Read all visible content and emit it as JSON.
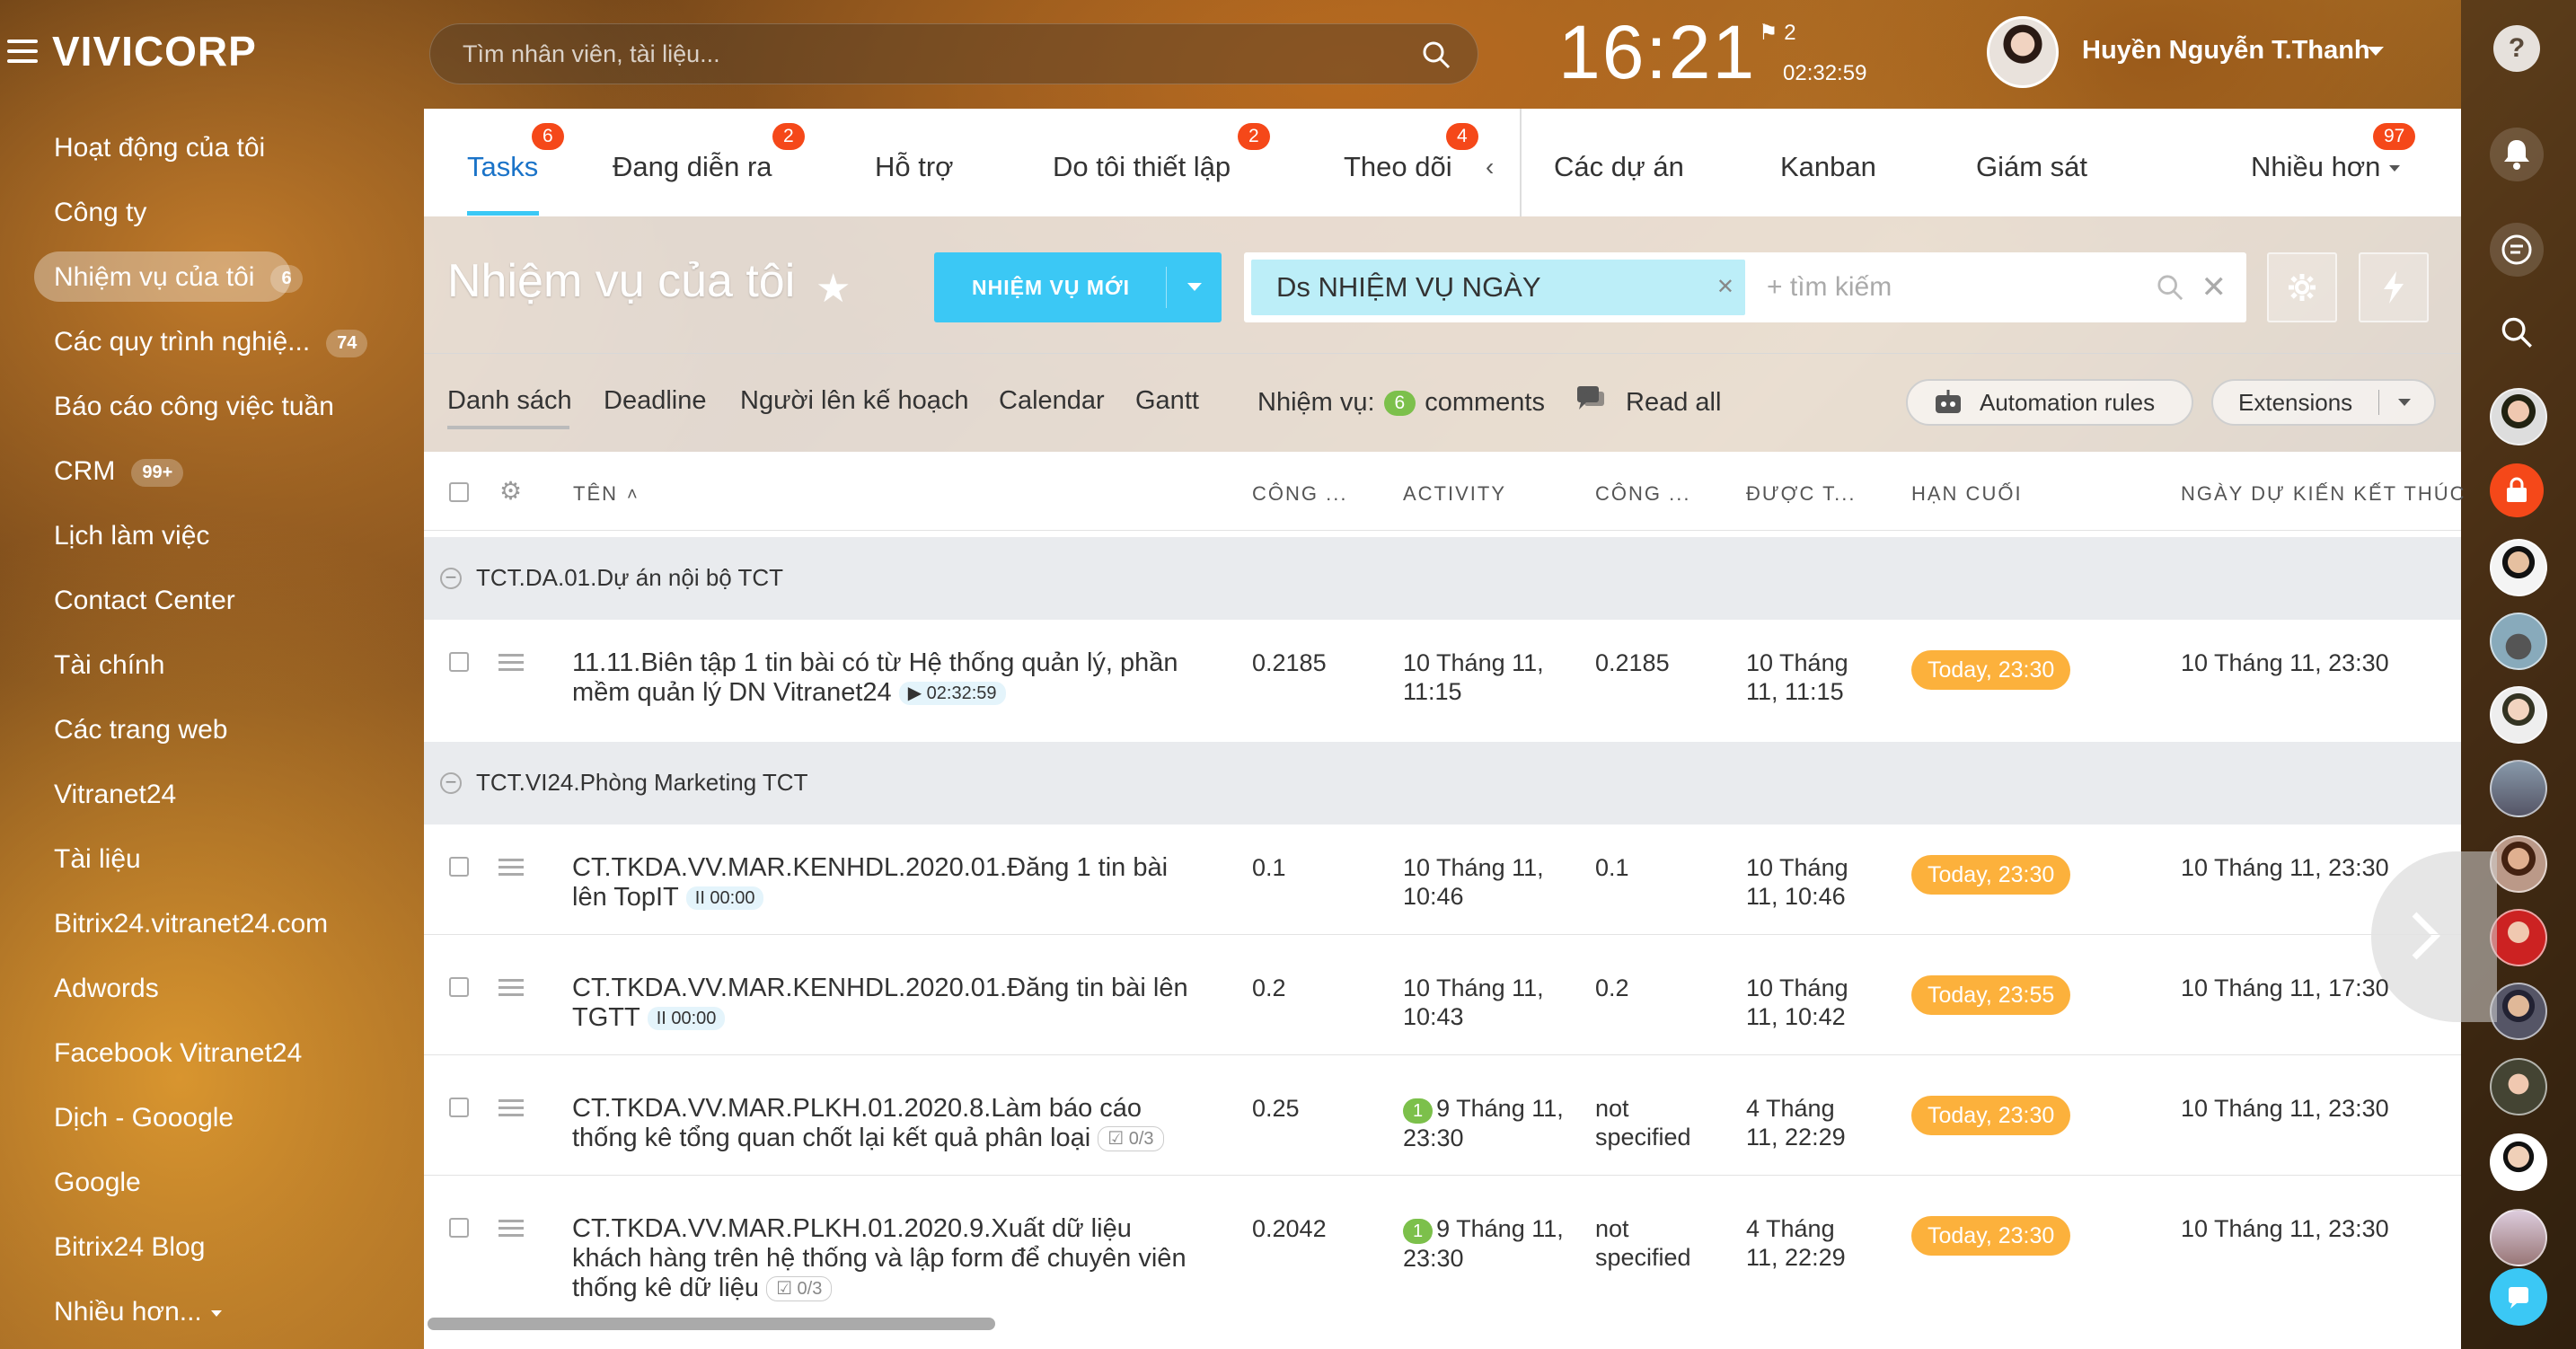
{
  "header": {
    "logo": "VIVICORP",
    "search_placeholder": "Tìm nhân viên, tài liệu...",
    "clock": "16:21",
    "flag_count": "2",
    "timer": "02:32:59",
    "user_name": "Huyền Nguyễn T.Thanh"
  },
  "sidebar": {
    "items": [
      {
        "label": "Hoạt động của tôi"
      },
      {
        "label": "Công ty"
      },
      {
        "label": "Nhiệm vụ của tôi",
        "badge": "6"
      },
      {
        "label": "Các quy trình nghiệ...",
        "badge": "74"
      },
      {
        "label": "Báo cáo công việc tuần"
      },
      {
        "label": "CRM",
        "badge": "99+"
      },
      {
        "label": "Lịch làm việc"
      },
      {
        "label": "Contact Center"
      },
      {
        "label": "Tài chính"
      },
      {
        "label": "Các trang web"
      },
      {
        "label": "Vitranet24"
      },
      {
        "label": "Tài liệu"
      },
      {
        "label": "Bitrix24.vitranet24.com"
      },
      {
        "label": "Adwords"
      },
      {
        "label": "Facebook Vitranet24"
      },
      {
        "label": "Dịch - Gooogle"
      },
      {
        "label": "Google"
      },
      {
        "label": "Bitrix24 Blog"
      },
      {
        "label": "Nhiều hơn..."
      }
    ]
  },
  "tabs": [
    {
      "label": "Tasks",
      "badge": "6"
    },
    {
      "label": "Đang diễn ra",
      "badge": "2"
    },
    {
      "label": "Hỗ trợ"
    },
    {
      "label": "Do tôi thiết lập",
      "badge": "2"
    },
    {
      "label": "Theo dõi",
      "badge": "4"
    },
    {
      "label": "Các dự án"
    },
    {
      "label": "Kanban"
    },
    {
      "label": "Giám sát"
    },
    {
      "label": "Nhiều hơn",
      "badge": "97"
    }
  ],
  "toolbar": {
    "page_title": "Nhiệm vụ của tôi",
    "new_button": "NHIỆM VỤ MỚI",
    "filter_chip": "Ds NHIỆM VỤ NGÀY",
    "filter_placeholder": "+ tìm kiếm"
  },
  "subtabs": [
    "Danh sách",
    "Deadline",
    "Người lên kế hoạch",
    "Calendar",
    "Gantt"
  ],
  "counter": {
    "label": "Nhiệm vụ:",
    "count": "6",
    "suffix": "comments",
    "read_all": "Read all"
  },
  "pills": {
    "automation": "Automation rules",
    "extensions": "Extensions"
  },
  "table": {
    "columns": [
      "TÊN",
      "CÔNG ...",
      "ACTIVITY",
      "CÔNG ...",
      "ĐƯỢC T...",
      "HẠN CUỐI",
      "NGÀY DỰ KIẾN KẾT THÚC"
    ],
    "groups": [
      {
        "title": "TCT.DA.01.Dự án nội bộ TCT",
        "rows": [
          {
            "name": "11.11.Biên tập 1 tin bài có từ Hệ thống quản lý, phần mềm quản lý DN Vitranet24",
            "badge": "▶ 02:32:59",
            "c1": "0.2185",
            "activity": "10 Tháng 11, 11:15",
            "act_badge": "",
            "c2": "0.2185",
            "created": "10 Tháng 11, 11:15",
            "deadline": "Today, 23:30",
            "end": "10 Tháng 11, 23:30"
          }
        ]
      },
      {
        "title": "TCT.VI24.Phòng Marketing TCT",
        "rows": [
          {
            "name": "CT.TKDA.VV.MAR.KENHDL.2020.01.Đăng 1 tin bài lên TopIT",
            "badge": "II 00:00",
            "c1": "0.1",
            "activity": "10 Tháng 11, 10:46",
            "act_badge": "",
            "c2": "0.1",
            "created": "10 Tháng 11, 10:46",
            "deadline": "Today, 23:30",
            "end": "10 Tháng 11, 23:30"
          },
          {
            "name": "CT.TKDA.VV.MAR.KENHDL.2020.01.Đăng tin bài lên TGTT",
            "badge": "II 00:00",
            "c1": "0.2",
            "activity": "10 Tháng 11, 10:43",
            "act_badge": "",
            "c2": "0.2",
            "created": "10 Tháng 11, 10:42",
            "deadline": "Today, 23:55",
            "end": "10 Tháng 11, 17:30"
          },
          {
            "name": "CT.TKDA.VV.MAR.PLKH.01.2020.8.Làm báo cáo thống kê tổng quan chốt lại kết quả phân loại",
            "badge": "☑ 0/3",
            "c1": "0.25",
            "activity": "9 Tháng 11, 23:30",
            "act_badge": "1",
            "c2": "not specified",
            "created": "4 Tháng 11, 22:29",
            "deadline": "Today, 23:30",
            "end": "10 Tháng 11, 23:30"
          },
          {
            "name": "CT.TKDA.VV.MAR.PLKH.01.2020.9.Xuất dữ liệu khách hàng trên hệ thống và lập form để chuyên viên thống kê dữ liệu",
            "badge": "☑ 0/3",
            "c1": "0.2042",
            "activity": "9 Tháng 11, 23:30",
            "act_badge": "1",
            "c2": "not specified",
            "created": "4 Tháng 11, 22:29",
            "deadline": "Today, 23:30",
            "end": "10 Tháng 11, 23:30"
          }
        ]
      }
    ]
  },
  "colors": {
    "accent": "#3bc8f5",
    "badge_red": "#f54819",
    "deadline": "#fcb13c",
    "green": "#7cc04b"
  }
}
